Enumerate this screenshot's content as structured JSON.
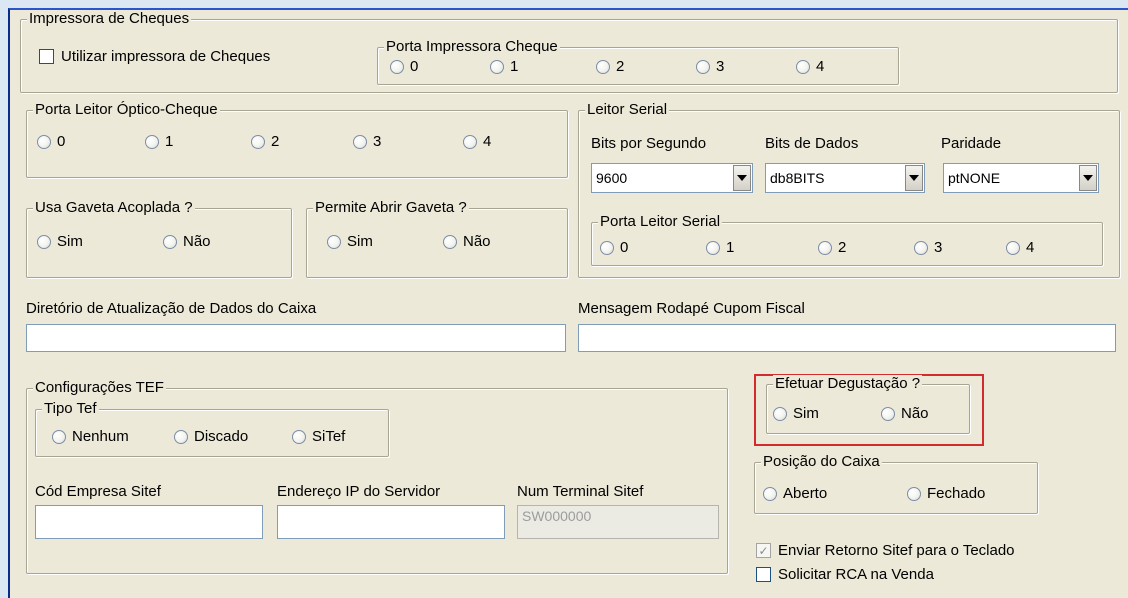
{
  "impressora": {
    "title": "Impressora de Cheques",
    "use_checkbox_label": "Utilizar impressora de Cheques",
    "porta_title": "Porta Impressora Cheque",
    "porta_options": [
      "0",
      "1",
      "2",
      "3",
      "4"
    ]
  },
  "leitor_optico": {
    "title": "Porta Leitor Óptico-Cheque",
    "options": [
      "0",
      "1",
      "2",
      "3",
      "4"
    ]
  },
  "gaveta_acoplada": {
    "title": "Usa Gaveta Acoplada ?",
    "options": [
      "Sim",
      "Não"
    ]
  },
  "abrir_gaveta": {
    "title": "Permite Abrir Gaveta ?",
    "options": [
      "Sim",
      "Não"
    ]
  },
  "leitor_serial": {
    "title": "Leitor Serial",
    "bits_segundo_label": "Bits por Segundo",
    "bits_segundo_value": "9600",
    "bits_dados_label": "Bits de Dados",
    "bits_dados_value": "db8BITS",
    "paridade_label": "Paridade",
    "paridade_value": "ptNONE",
    "porta_title": "Porta Leitor Serial",
    "porta_options": [
      "0",
      "1",
      "2",
      "3",
      "4"
    ]
  },
  "diretorio": {
    "label": "Diretório de Atualização de Dados do Caixa",
    "value": ""
  },
  "mensagem": {
    "label": "Mensagem Rodapé Cupom Fiscal",
    "value": ""
  },
  "tef": {
    "title": "Configurações TEF",
    "tipo_title": "Tipo Tef",
    "tipo_options": [
      "Nenhum",
      "Discado",
      "SiTef"
    ],
    "cod_empresa_label": "Cód Empresa Sitef",
    "cod_empresa_value": "",
    "ip_label": "Endereço IP do Servidor",
    "ip_value": "",
    "terminal_label": "Num Terminal Sitef",
    "terminal_value": "SW000000"
  },
  "degustacao": {
    "title": "Efetuar Degustação ?",
    "options": [
      "Sim",
      "Não"
    ]
  },
  "posicao": {
    "title": "Posição do Caixa",
    "options": [
      "Aberto",
      "Fechado"
    ]
  },
  "checks": {
    "enviar_retorno": "Enviar Retorno Sitef para o Teclado",
    "solicitar_rca": "Solicitar RCA na Venda"
  },
  "colors": {
    "highlight": "#d22c2c",
    "window_bg": "#ece9d8"
  }
}
